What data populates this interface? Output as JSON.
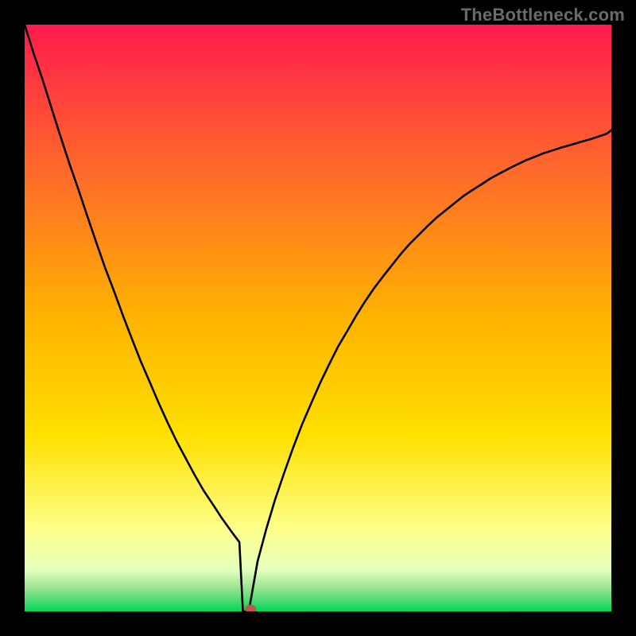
{
  "watermark": "TheBottleneck.com",
  "chart_data": {
    "type": "line",
    "title": "",
    "xlabel": "",
    "ylabel": "",
    "xlim": [
      0,
      100
    ],
    "ylim": [
      0,
      100
    ],
    "grid": false,
    "legend": false,
    "background_gradient": {
      "stops": [
        {
          "offset": 0.0,
          "color": "#ff1a4d"
        },
        {
          "offset": 0.25,
          "color": "#ff6a2a"
        },
        {
          "offset": 0.5,
          "color": "#ffb300"
        },
        {
          "offset": 0.7,
          "color": "#ffe000"
        },
        {
          "offset": 0.86,
          "color": "#feff8a"
        },
        {
          "offset": 0.93,
          "color": "#e4ffbe"
        },
        {
          "offset": 0.965,
          "color": "#8be08b"
        },
        {
          "offset": 1.0,
          "color": "#00d65a"
        }
      ]
    },
    "series": [
      {
        "name": "bottleneck-curve",
        "x": [
          0.0,
          1.5,
          3.1,
          4.6,
          6.1,
          7.6,
          9.2,
          10.7,
          12.2,
          13.7,
          15.3,
          16.8,
          18.3,
          19.8,
          21.4,
          22.9,
          24.4,
          25.9,
          27.5,
          29.0,
          30.5,
          32.1,
          33.6,
          35.1,
          36.6,
          37.2,
          38.2,
          39.7,
          41.2,
          42.7,
          44.3,
          45.8,
          47.3,
          48.9,
          50.4,
          51.9,
          53.4,
          55.0,
          56.5,
          58.0,
          59.5,
          61.1,
          62.6,
          64.1,
          65.6,
          67.2,
          68.7,
          70.2,
          71.8,
          73.3,
          74.8,
          76.3,
          77.9,
          79.4,
          80.9,
          82.4,
          84.0,
          85.5,
          87.0,
          88.5,
          90.1,
          91.6,
          93.1,
          94.7,
          96.2,
          97.7,
          99.2,
          100.0
        ],
        "y": [
          100.0,
          95.2,
          90.5,
          85.7,
          81.0,
          76.4,
          71.8,
          67.3,
          62.9,
          58.6,
          54.4,
          50.3,
          46.4,
          42.6,
          38.9,
          35.4,
          32.1,
          29.0,
          26.0,
          23.2,
          20.6,
          18.2,
          15.9,
          13.8,
          11.8,
          0.0,
          0.0,
          8.5,
          14.1,
          19.1,
          23.8,
          28.0,
          31.9,
          35.6,
          39.0,
          42.1,
          45.1,
          47.8,
          50.4,
          52.8,
          55.0,
          57.1,
          59.0,
          60.9,
          62.6,
          64.2,
          65.7,
          67.1,
          68.4,
          69.6,
          70.8,
          71.8,
          72.8,
          73.8,
          74.6,
          75.4,
          76.2,
          76.9,
          77.5,
          78.1,
          78.6,
          79.1,
          79.5,
          80.0,
          80.4,
          80.9,
          81.4,
          82.0
        ]
      }
    ],
    "marker": {
      "x": 38.5,
      "y": 0.0,
      "color": "#c0574a"
    }
  }
}
